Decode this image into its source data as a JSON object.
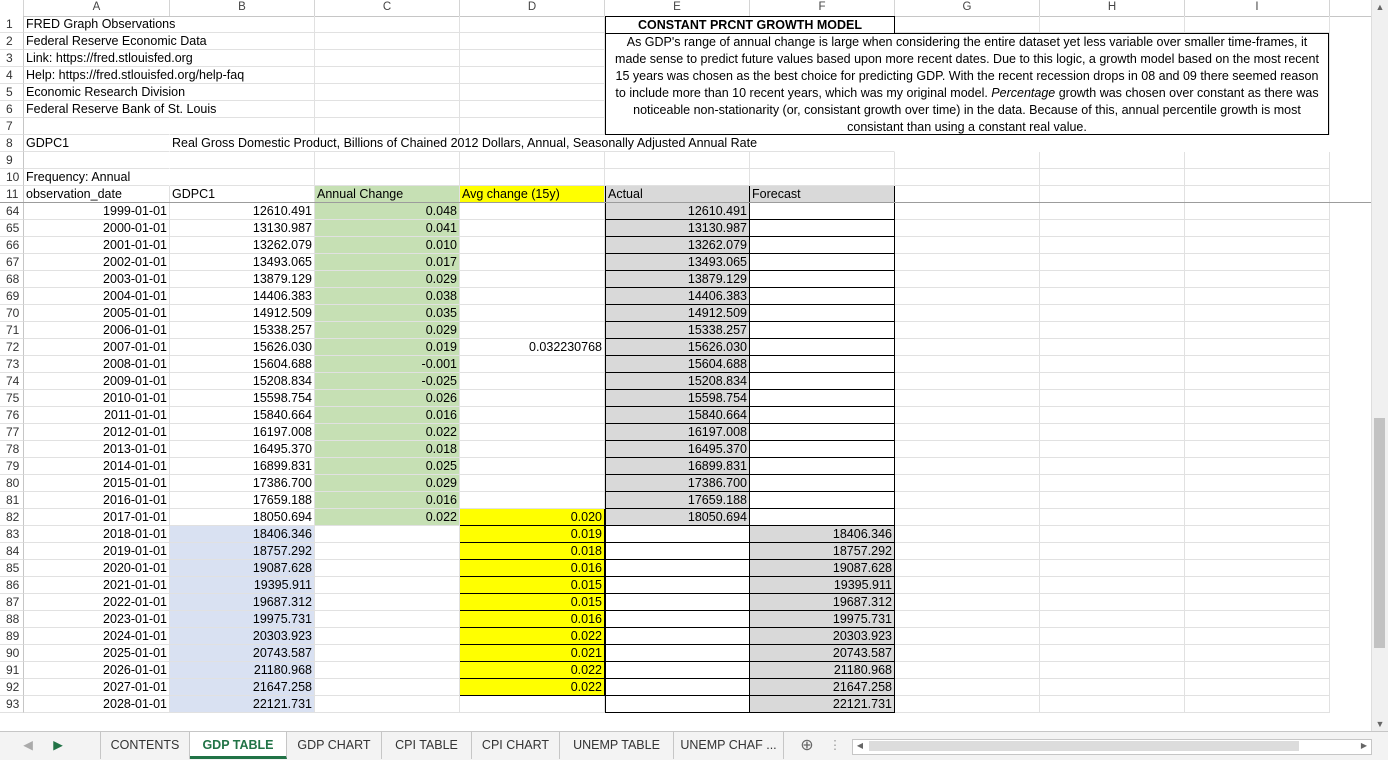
{
  "column_headers": [
    "A",
    "B",
    "C",
    "D",
    "E",
    "F",
    "G",
    "H",
    "I"
  ],
  "header_rows": [
    {
      "n": "1",
      "a": "FRED Graph Observations"
    },
    {
      "n": "2",
      "a": "Federal Reserve Economic Data"
    },
    {
      "n": "3",
      "a": "Link: https://fred.stlouisfed.org"
    },
    {
      "n": "4",
      "a": "Help: https://fred.stlouisfed.org/help-faq"
    },
    {
      "n": "5",
      "a": "Economic Research Division"
    },
    {
      "n": "6",
      "a": "Federal Reserve Bank of St. Louis"
    },
    {
      "n": "7",
      "a": ""
    },
    {
      "n": "8",
      "a": "GDPC1",
      "b": "Real Gross Domestic Product, Billions of Chained 2012 Dollars, Annual, Seasonally Adjusted Annual Rate"
    },
    {
      "n": "9",
      "a": ""
    },
    {
      "n": "10",
      "a": "Frequency: Annual"
    }
  ],
  "model_title": "CONSTANT PRCNT GROWTH MODEL",
  "model_text_1": "As GDP's range of annual change is large when considering the entire dataset yet less variable over smaller time-frames, it made sense to predict future values based upon more recent dates. Due to this logic, a growth model based on the most recent 15 years was chosen as the best choice for predicting GDP. With the recent recession drops in 08 and 09 there seemed reason to include more than 10 recent years, which was my original model. ",
  "model_text_em": "Percentage",
  "model_text_2": " growth was chosen over constant as there was noticeable non-stationarity (or, consistant growth over time) in the data. Because of this, annual percentile growth is most consistant than using a constant real value.",
  "table_headers": {
    "n": "11",
    "a": "observation_date",
    "b": "GDPC1",
    "c": "Annual Change",
    "d": "Avg change (15y)",
    "e": "Actual",
    "f": "Forecast"
  },
  "rows": [
    {
      "n": "64",
      "a": "1999-01-01",
      "b": "12610.491",
      "c": "0.048",
      "d": "",
      "e": "12610.491",
      "f": ""
    },
    {
      "n": "65",
      "a": "2000-01-01",
      "b": "13130.987",
      "c": "0.041",
      "d": "",
      "e": "13130.987",
      "f": ""
    },
    {
      "n": "66",
      "a": "2001-01-01",
      "b": "13262.079",
      "c": "0.010",
      "d": "",
      "e": "13262.079",
      "f": ""
    },
    {
      "n": "67",
      "a": "2002-01-01",
      "b": "13493.065",
      "c": "0.017",
      "d": "",
      "e": "13493.065",
      "f": ""
    },
    {
      "n": "68",
      "a": "2003-01-01",
      "b": "13879.129",
      "c": "0.029",
      "d": "",
      "e": "13879.129",
      "f": ""
    },
    {
      "n": "69",
      "a": "2004-01-01",
      "b": "14406.383",
      "c": "0.038",
      "d": "",
      "e": "14406.383",
      "f": ""
    },
    {
      "n": "70",
      "a": "2005-01-01",
      "b": "14912.509",
      "c": "0.035",
      "d": "",
      "e": "14912.509",
      "f": ""
    },
    {
      "n": "71",
      "a": "2006-01-01",
      "b": "15338.257",
      "c": "0.029",
      "d": "",
      "e": "15338.257",
      "f": ""
    },
    {
      "n": "72",
      "a": "2007-01-01",
      "b": "15626.030",
      "c": "0.019",
      "d": "0.032230768",
      "e": "15626.030",
      "f": ""
    },
    {
      "n": "73",
      "a": "2008-01-01",
      "b": "15604.688",
      "c": "-0.001",
      "d": "",
      "e": "15604.688",
      "f": ""
    },
    {
      "n": "74",
      "a": "2009-01-01",
      "b": "15208.834",
      "c": "-0.025",
      "d": "",
      "e": "15208.834",
      "f": ""
    },
    {
      "n": "75",
      "a": "2010-01-01",
      "b": "15598.754",
      "c": "0.026",
      "d": "",
      "e": "15598.754",
      "f": ""
    },
    {
      "n": "76",
      "a": "2011-01-01",
      "b": "15840.664",
      "c": "0.016",
      "d": "",
      "e": "15840.664",
      "f": ""
    },
    {
      "n": "77",
      "a": "2012-01-01",
      "b": "16197.008",
      "c": "0.022",
      "d": "",
      "e": "16197.008",
      "f": ""
    },
    {
      "n": "78",
      "a": "2013-01-01",
      "b": "16495.370",
      "c": "0.018",
      "d": "",
      "e": "16495.370",
      "f": ""
    },
    {
      "n": "79",
      "a": "2014-01-01",
      "b": "16899.831",
      "c": "0.025",
      "d": "",
      "e": "16899.831",
      "f": ""
    },
    {
      "n": "80",
      "a": "2015-01-01",
      "b": "17386.700",
      "c": "0.029",
      "d": "",
      "e": "17386.700",
      "f": ""
    },
    {
      "n": "81",
      "a": "2016-01-01",
      "b": "17659.188",
      "c": "0.016",
      "d": "",
      "e": "17659.188",
      "f": ""
    },
    {
      "n": "82",
      "a": "2017-01-01",
      "b": "18050.694",
      "c": "0.022",
      "d": "0.020",
      "e": "18050.694",
      "f": ""
    },
    {
      "n": "83",
      "a": "2018-01-01",
      "b": "18406.346",
      "c": "",
      "d": "0.019",
      "e": "",
      "f": "18406.346"
    },
    {
      "n": "84",
      "a": "2019-01-01",
      "b": "18757.292",
      "c": "",
      "d": "0.018",
      "e": "",
      "f": "18757.292"
    },
    {
      "n": "85",
      "a": "2020-01-01",
      "b": "19087.628",
      "c": "",
      "d": "0.016",
      "e": "",
      "f": "19087.628"
    },
    {
      "n": "86",
      "a": "2021-01-01",
      "b": "19395.911",
      "c": "",
      "d": "0.015",
      "e": "",
      "f": "19395.911"
    },
    {
      "n": "87",
      "a": "2022-01-01",
      "b": "19687.312",
      "c": "",
      "d": "0.015",
      "e": "",
      "f": "19687.312"
    },
    {
      "n": "88",
      "a": "2023-01-01",
      "b": "19975.731",
      "c": "",
      "d": "0.016",
      "e": "",
      "f": "19975.731"
    },
    {
      "n": "89",
      "a": "2024-01-01",
      "b": "20303.923",
      "c": "",
      "d": "0.022",
      "e": "",
      "f": "20303.923"
    },
    {
      "n": "90",
      "a": "2025-01-01",
      "b": "20743.587",
      "c": "",
      "d": "0.021",
      "e": "",
      "f": "20743.587"
    },
    {
      "n": "91",
      "a": "2026-01-01",
      "b": "21180.968",
      "c": "",
      "d": "0.022",
      "e": "",
      "f": "21180.968"
    },
    {
      "n": "92",
      "a": "2027-01-01",
      "b": "21647.258",
      "c": "",
      "d": "0.022",
      "e": "",
      "f": "21647.258"
    },
    {
      "n": "93",
      "a": "2028-01-01",
      "b": "22121.731",
      "c": "",
      "d": "",
      "e": "",
      "f": "22121.731"
    }
  ],
  "tabs": [
    {
      "label": "CONTENTS",
      "active": false
    },
    {
      "label": "GDP TABLE",
      "active": true
    },
    {
      "label": "GDP CHART",
      "active": false
    },
    {
      "label": "CPI TABLE",
      "active": false
    },
    {
      "label": "CPI CHART",
      "active": false
    },
    {
      "label": "UNEMP TABLE",
      "active": false
    },
    {
      "label": "UNEMP CHAF ...",
      "active": false
    }
  ],
  "colors": {
    "green": "#c6e0b4",
    "yellow": "#ffff00",
    "gray": "#d9d9d9",
    "blue": "#d9e1f2",
    "accent": "#217346"
  }
}
